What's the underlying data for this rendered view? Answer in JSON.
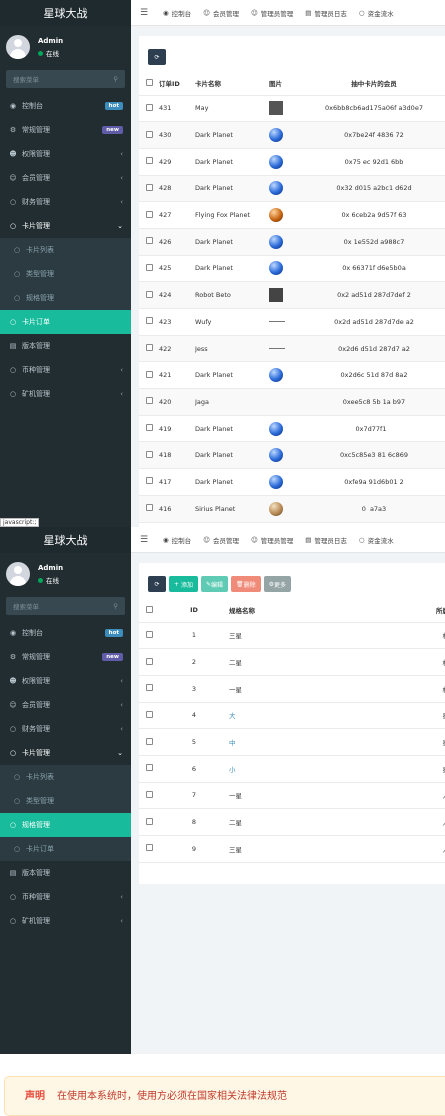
{
  "app_title": "星球大战",
  "user": {
    "name": "Admin",
    "status": "在线"
  },
  "search_placeholder": "搜索菜单",
  "menu": {
    "dashboard": "控制台",
    "dashboard_badge": "hot",
    "general": "常规管理",
    "general_badge": "new",
    "auth": "权限管理",
    "member": "会员管理",
    "finance": "财务管理",
    "card": "卡片管理",
    "card_list": "卡片列表",
    "card_type": "类型管理",
    "card_spec": "规格管理",
    "card_order": "卡片订单",
    "version": "版本管理",
    "currency": "币种管理",
    "miner": "矿机管理"
  },
  "tabs": [
    "控制台",
    "会员管理",
    "管理员管理",
    "管理员日志",
    "资金流水"
  ],
  "panel1": {
    "columns": [
      "订单ID",
      "卡片名称",
      "图片",
      "抽中卡片的会员"
    ],
    "rows": [
      {
        "id": "431",
        "name": "May",
        "img": "square",
        "addr_a": "0x6bb8cb6ad175a06f",
        "addr_b": "a3d0e7"
      },
      {
        "id": "430",
        "name": "Dark Planet",
        "img": "blue",
        "addr_a": "0x7be24f",
        "addr_b": "4836",
        "addr_c": "72"
      },
      {
        "id": "429",
        "name": "Dark Planet",
        "img": "blue",
        "addr_a": "0x75",
        "addr_b": "ec",
        "addr_c": "92d1",
        "addr_d": "6bb"
      },
      {
        "id": "428",
        "name": "Dark Planet",
        "img": "blue",
        "addr_a": "0x32",
        "addr_b": "d015",
        "addr_c": "a2bc1",
        "addr_d": "d62d"
      },
      {
        "id": "427",
        "name": "Flying Fox Planet",
        "img": "orange",
        "addr_a": "0x",
        "addr_b": "6ceb2a",
        "addr_c": "9d57f",
        "addr_d": "63"
      },
      {
        "id": "426",
        "name": "Dark Planet",
        "img": "blue",
        "addr_a": "0x",
        "addr_b": "1e552d",
        "addr_c": "a988c7"
      },
      {
        "id": "425",
        "name": "Dark Planet",
        "img": "blue",
        "addr_a": "0x",
        "addr_b": "66371f",
        "addr_c": "d6e5b0a"
      },
      {
        "id": "424",
        "name": "Robot Beto",
        "img": "robot",
        "addr_a": "0x2",
        "addr_b": "ad51d",
        "addr_c": "287d7def",
        "addr_d": "2"
      },
      {
        "id": "423",
        "name": "Wufy",
        "img": "line",
        "addr_a": "0x2d",
        "addr_b": "ad51d",
        "addr_c": "287d7de",
        "addr_d": "a2"
      },
      {
        "id": "422",
        "name": "Jess",
        "img": "line",
        "addr_a": "0x2d6",
        "addr_b": "d51d",
        "addr_c": "287d7",
        "addr_d": "a2"
      },
      {
        "id": "421",
        "name": "Dark Planet",
        "img": "blue",
        "addr_a": "0x2d6c",
        "addr_b": "51d",
        "addr_c": "87d",
        "addr_d": "8a2"
      },
      {
        "id": "420",
        "name": "Jaga",
        "img": "none",
        "addr_a": "0xee5c8",
        "addr_b": "5b",
        "addr_c": "1a",
        "addr_d": "b97"
      },
      {
        "id": "419",
        "name": "Dark Planet",
        "img": "blue",
        "addr_a": "0x7d77f1",
        "addr_b": "",
        "addr_c": "",
        "addr_d": ""
      },
      {
        "id": "418",
        "name": "Dark Planet",
        "img": "blue",
        "addr_a": "0xc5c85e3",
        "addr_b": "81",
        "addr_c": "6c869"
      },
      {
        "id": "417",
        "name": "Dark Planet",
        "img": "blue",
        "addr_a": "0xfe9a",
        "addr_b": "91d6b01",
        "addr_c": "2"
      },
      {
        "id": "416",
        "name": "Sirius Planet",
        "img": "tan",
        "addr_a": "0",
        "addr_b": "",
        "addr_c": "a7a3"
      }
    ]
  },
  "panel2": {
    "buttons": {
      "add": "添加",
      "edit": "编辑",
      "delete": "删除",
      "more": "更多"
    },
    "columns": [
      "ID",
      "规格名称",
      "所属"
    ],
    "rows": [
      {
        "id": "1",
        "name": "三星",
        "tail": "机"
      },
      {
        "id": "2",
        "name": "二星",
        "tail": "机"
      },
      {
        "id": "3",
        "name": "一星",
        "tail": "机"
      },
      {
        "id": "4",
        "name": "大",
        "tail": "星"
      },
      {
        "id": "5",
        "name": "中",
        "tail": "星"
      },
      {
        "id": "6",
        "name": "小",
        "tail": "星"
      },
      {
        "id": "7",
        "name": "一星",
        "tail": "人"
      },
      {
        "id": "8",
        "name": "二星",
        "tail": "人"
      },
      {
        "id": "9",
        "name": "三星",
        "tail": "人"
      }
    ]
  },
  "js_note": "javascript:;",
  "notice": {
    "label": "声明",
    "text": "在使用本系统时，使用方必须在国家相关法律法规范"
  }
}
